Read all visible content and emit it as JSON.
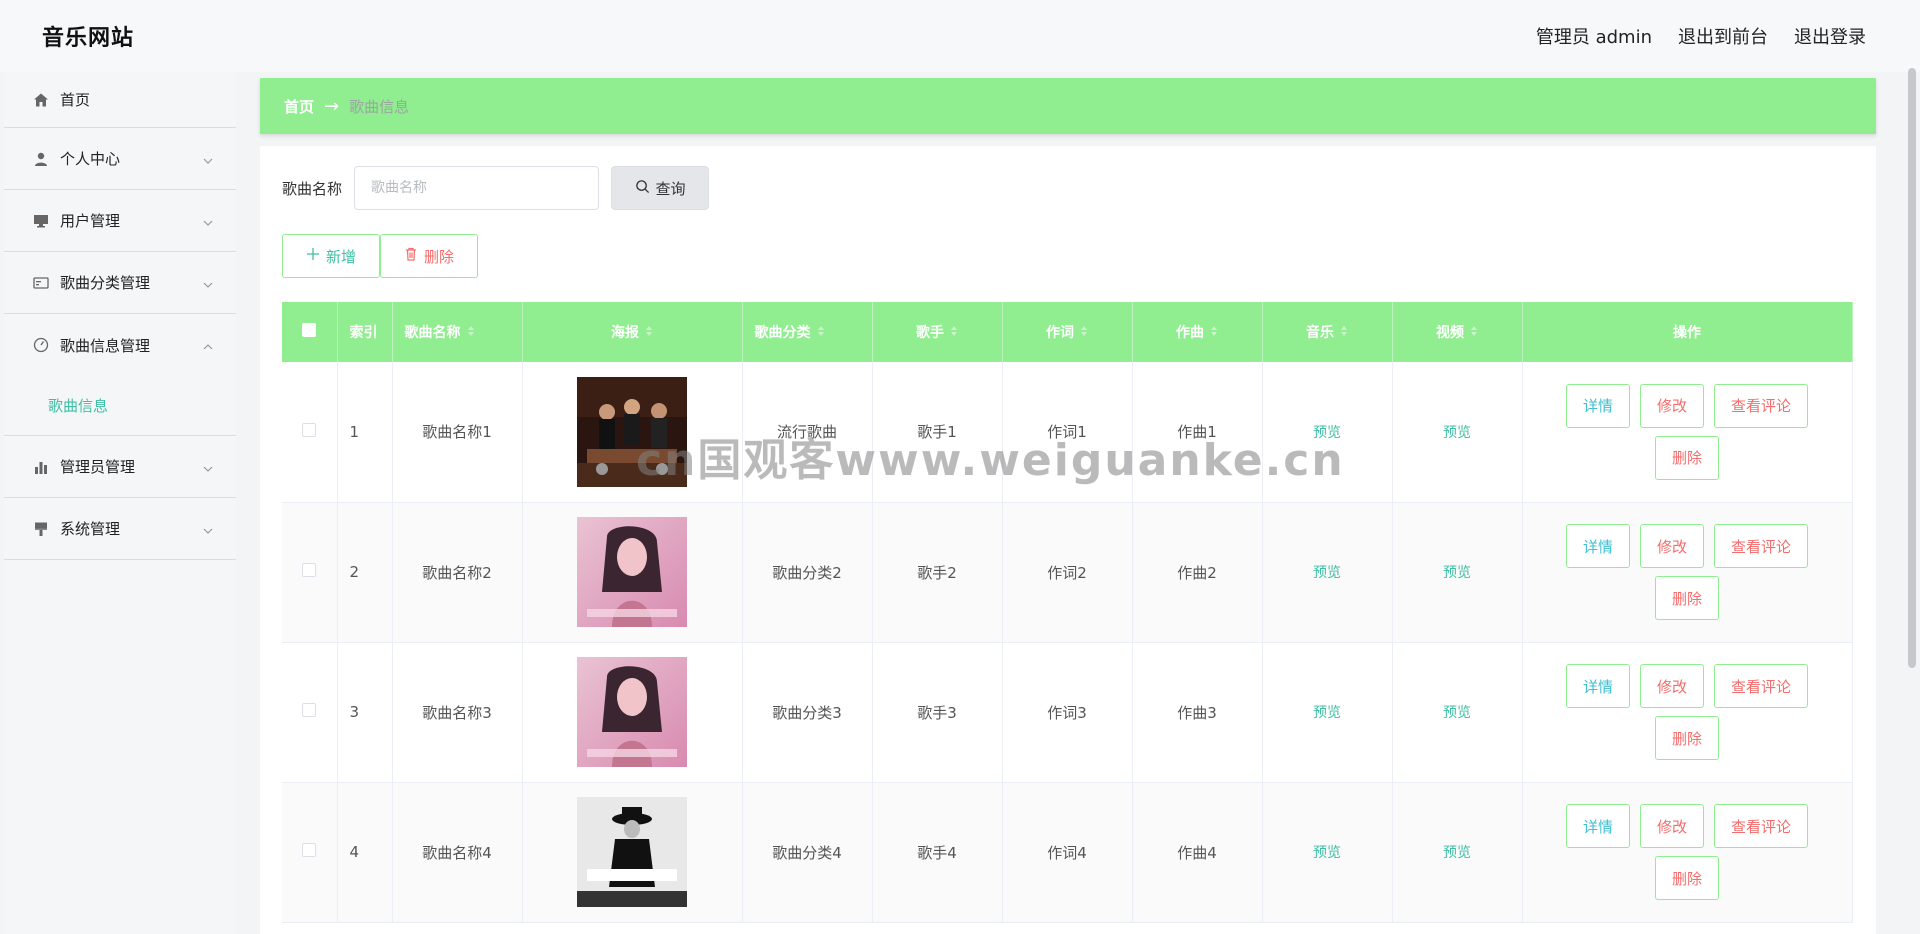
{
  "header": {
    "title": "音乐网站",
    "admin_label": "管理员 admin",
    "back_to_front": "退出到前台",
    "logout": "退出登录"
  },
  "sidebar": {
    "items": [
      {
        "label": "首页",
        "icon": "home-icon"
      },
      {
        "label": "个人中心",
        "icon": "user-icon"
      },
      {
        "label": "用户管理",
        "icon": "monitor-icon"
      },
      {
        "label": "歌曲分类管理",
        "icon": "card-icon"
      },
      {
        "label": "歌曲信息管理",
        "icon": "gauge-icon"
      },
      {
        "label": "管理员管理",
        "icon": "bar-chart-icon"
      },
      {
        "label": "系统管理",
        "icon": "brush-icon"
      }
    ],
    "submenu": {
      "label": "歌曲信息"
    }
  },
  "breadcrumb": {
    "home": "首页",
    "arrow": "→",
    "current": "歌曲信息"
  },
  "search": {
    "label": "歌曲名称",
    "placeholder": "歌曲名称",
    "query_label": "查询"
  },
  "actions": {
    "add_label": "新增",
    "delete_label": "删除"
  },
  "table": {
    "columns": [
      "索引",
      "歌曲名称",
      "海报",
      "歌曲分类",
      "歌手",
      "作词",
      "作曲",
      "音乐",
      "视频",
      "操作"
    ],
    "rows": [
      {
        "index": "1",
        "name": "歌曲名称1",
        "category": "流行歌曲",
        "singer": "歌手1",
        "lyricist": "作词1",
        "composer": "作曲1",
        "music": "预览",
        "video": "预览",
        "poster": "band"
      },
      {
        "index": "2",
        "name": "歌曲名称2",
        "category": "歌曲分类2",
        "singer": "歌手2",
        "lyricist": "作词2",
        "composer": "作曲2",
        "music": "预览",
        "video": "预览",
        "poster": "woman"
      },
      {
        "index": "3",
        "name": "歌曲名称3",
        "category": "歌曲分类3",
        "singer": "歌手3",
        "lyricist": "作词3",
        "composer": "作曲3",
        "music": "预览",
        "video": "预览",
        "poster": "woman"
      },
      {
        "index": "4",
        "name": "歌曲名称4",
        "category": "歌曲分类4",
        "singer": "歌手4",
        "lyricist": "作词4",
        "composer": "作曲4",
        "music": "预览",
        "video": "预览",
        "poster": "man"
      }
    ],
    "ops": {
      "detail": "详情",
      "edit": "修改",
      "comment": "查看评论",
      "remove": "删除"
    }
  },
  "watermark": "cn国观客www.weiguanke.cn",
  "colors": {
    "accent": "#90ee90",
    "link": "#3fbfa3",
    "danger": "#f56c6c"
  }
}
